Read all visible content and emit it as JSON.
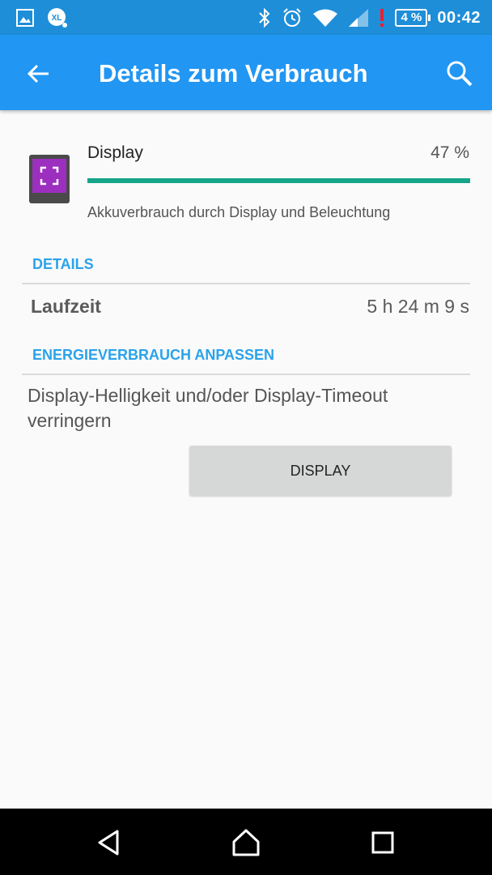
{
  "status_bar": {
    "time": "00:42",
    "battery": "4 %",
    "left_icons": [
      "gallery-icon",
      "xl-app-icon"
    ],
    "right_icons": [
      "bluetooth-icon",
      "alarm-icon",
      "wifi-icon",
      "cellular-signal-icon",
      "battery-warning-icon"
    ]
  },
  "app_bar": {
    "title": "Details zum Verbrauch",
    "color": "#2196f3"
  },
  "usage_item": {
    "name": "Display",
    "percent": "47 %",
    "percent_value": 0.47,
    "description": "Akkuverbrauch durch Display und Beleuchtung",
    "icon": "display-app-icon",
    "bar_color": "#16a589"
  },
  "details": {
    "header": "DETAILS",
    "runtime_label": "Laufzeit",
    "runtime_value": "5 h 24 m 9 s"
  },
  "adjust": {
    "header": "ENERGIEVERBRAUCH ANPASSEN",
    "tip": "Display-Helligkeit und/oder Display-Timeout verringern",
    "button_label": "DISPLAY"
  },
  "nav_bar": {
    "icons": [
      "back-nav-icon",
      "home-nav-icon",
      "recents-nav-icon"
    ]
  }
}
